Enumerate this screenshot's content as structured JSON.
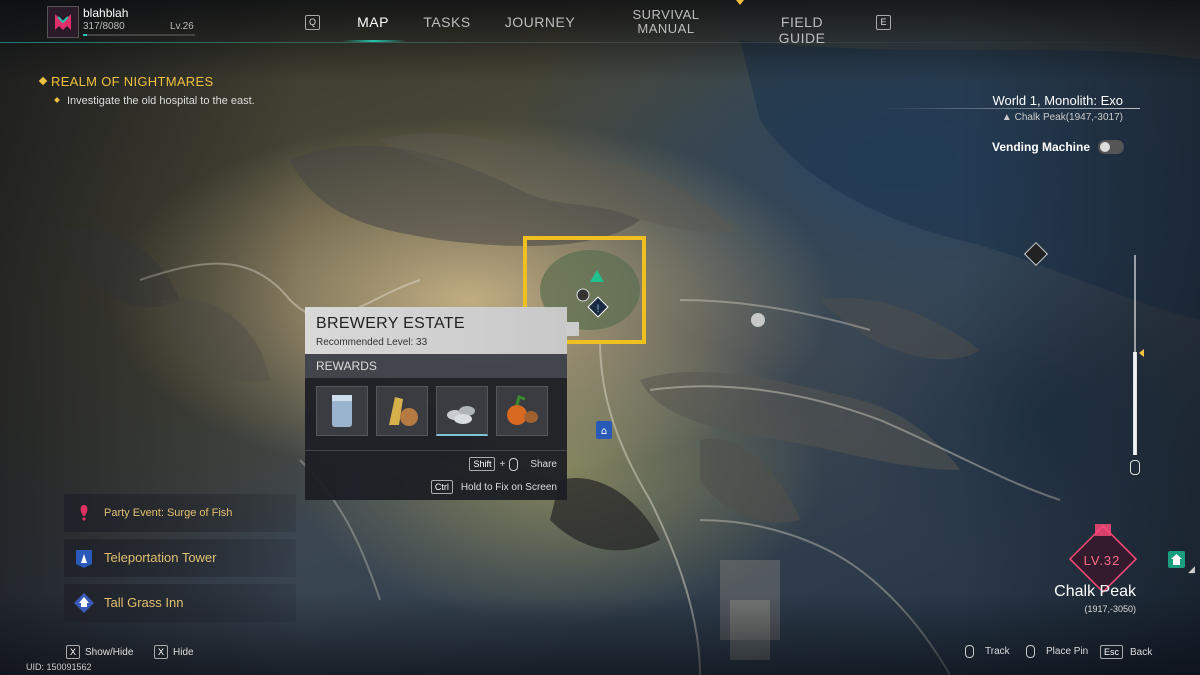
{
  "player": {
    "name": "blahblah",
    "xp": "317/8080",
    "level": "Lv.26",
    "xp_progress": 0.039
  },
  "nav": {
    "key_left": "Q",
    "key_right": "E",
    "tabs": [
      {
        "label": "MAP",
        "active": true
      },
      {
        "label": "TASKS"
      },
      {
        "label": "JOURNEY"
      },
      {
        "label": "SURVIVAL MANUAL"
      },
      {
        "label": "FIELD GUIDE"
      }
    ]
  },
  "quest": {
    "title": "REALM OF NIGHTMARES",
    "objective": "Investigate the old hospital to the east."
  },
  "world": {
    "name": "World 1, Monolith: Exo",
    "coords": "Chalk Peak(1947,-3017)",
    "vending_label": "Vending Machine",
    "vending_on": false
  },
  "popup": {
    "title": "BREWERY ESTATE",
    "recommended": "Recommended Level: 33",
    "rewards_label": "REWARDS",
    "rewards": [
      "canister-icon",
      "grain-icon",
      "stones-icon",
      "produce-icon"
    ],
    "share_key": "Shift",
    "share_plus": "+",
    "share_label": "Share",
    "fix_key": "Ctrl",
    "fix_label": "Hold to Fix on Screen"
  },
  "events": [
    {
      "label": "Party Event: Surge of Fish",
      "icon": "alert-icon"
    },
    {
      "label": "Teleportation Tower",
      "icon": "tower-icon"
    },
    {
      "label": "Tall Grass Inn",
      "icon": "inn-icon"
    }
  ],
  "bottom": {
    "showhide_key": "X",
    "showhide_label": "Show/Hide",
    "hide_key": "X",
    "hide_label": "Hide",
    "uid": "UID: 150091562",
    "track_label": "Track",
    "pin_label": "Place Pin",
    "back_key": "Esc",
    "back_label": "Back"
  },
  "region": {
    "level": "LV.32",
    "name": "Chalk Peak",
    "coords": "(1917,-3050)"
  },
  "colors": {
    "accent": "#25c4b0",
    "quest": "#f0c040",
    "highlight": "#f0c020",
    "level": "#ff6a8a"
  }
}
